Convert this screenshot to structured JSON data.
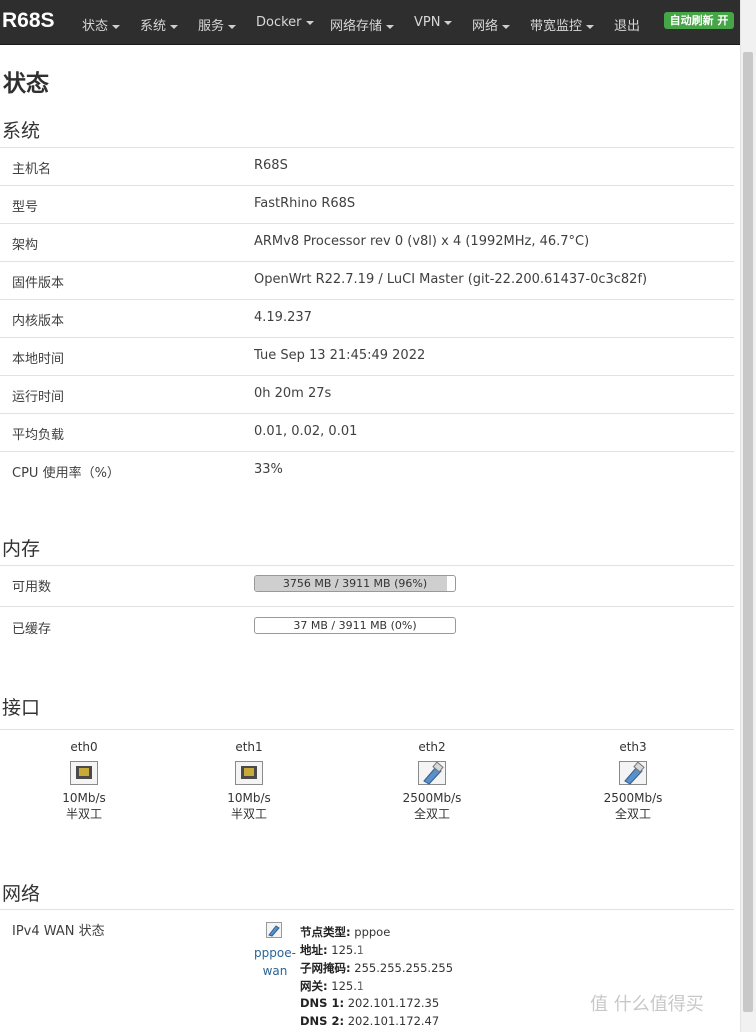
{
  "header": {
    "brand": "R68S",
    "menu": [
      {
        "label": "状态",
        "caret": true
      },
      {
        "label": "系统",
        "caret": true
      },
      {
        "label": "服务",
        "caret": true
      },
      {
        "label": "Docker",
        "caret": true
      },
      {
        "label": "网络存储",
        "caret": true
      },
      {
        "label": "VPN",
        "caret": true
      },
      {
        "label": "网络",
        "caret": true
      },
      {
        "label": "带宽监控",
        "caret": true
      },
      {
        "label": "退出",
        "caret": false
      }
    ],
    "refresh_label": "自动刷新 开",
    "refresh_color": "#46a546"
  },
  "page_title": "状态",
  "system": {
    "title": "系统",
    "rows": [
      {
        "label": "主机名",
        "value": "R68S"
      },
      {
        "label": "型号",
        "value": "FastRhino R68S"
      },
      {
        "label": "架构",
        "value": "ARMv8 Processor rev 0 (v8l) x 4 (1992MHz, 46.7°C)"
      },
      {
        "label": "固件版本",
        "value": "OpenWrt R22.7.19 / LuCI Master (git-22.200.61437-0c3c82f)"
      },
      {
        "label": "内核版本",
        "value": "4.19.237"
      },
      {
        "label": "本地时间",
        "value": "Tue Sep 13 21:45:49 2022"
      },
      {
        "label": "运行时间",
        "value": "0h 20m 27s"
      },
      {
        "label": "平均负载",
        "value": "0.01, 0.02, 0.01"
      },
      {
        "label": "CPU 使用率（%）",
        "value": "33%"
      }
    ]
  },
  "memory": {
    "title": "内存",
    "rows": [
      {
        "label": "可用数",
        "text": "3756 MB / 3911 MB (96%)",
        "percent": 96
      },
      {
        "label": "已缓存",
        "text": "37 MB / 3911 MB (0%)",
        "percent": 0
      }
    ]
  },
  "interfaces": {
    "title": "接口",
    "ports": [
      {
        "name": "eth0",
        "speed": "10Mb/s",
        "duplex": "半双工",
        "icon": "ethernet-port-down-icon"
      },
      {
        "name": "eth1",
        "speed": "10Mb/s",
        "duplex": "半双工",
        "icon": "ethernet-port-down-icon"
      },
      {
        "name": "eth2",
        "speed": "2500Mb/s",
        "duplex": "全双工",
        "icon": "ethernet-port-up-icon"
      },
      {
        "name": "eth3",
        "speed": "2500Mb/s",
        "duplex": "全双工",
        "icon": "ethernet-port-up-icon"
      }
    ]
  },
  "network": {
    "title": "网络",
    "ipv4_label": "IPv4 WAN 状态",
    "wan_link": "pppoe-wan",
    "details": [
      {
        "key": "节点类型:",
        "value": "pppoe"
      },
      {
        "key": "地址:",
        "value": "125.1"
      },
      {
        "key": "子网掩码:",
        "value": "255.255.255.255"
      },
      {
        "key": "网关:",
        "value": "125.1"
      },
      {
        "key": "DNS 1:",
        "value": "202.101.172.35"
      },
      {
        "key": "DNS 2:",
        "value": "202.101.172.47"
      }
    ]
  },
  "watermark": "值 什么值得买"
}
